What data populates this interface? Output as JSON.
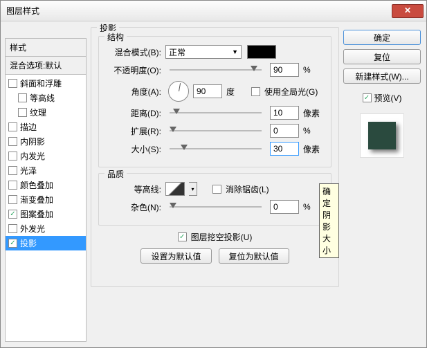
{
  "window": {
    "title": "图层样式"
  },
  "left": {
    "header": "样式",
    "sub": "混合选项:默认",
    "items": [
      {
        "label": "斜面和浮雕",
        "checked": false,
        "indent": false
      },
      {
        "label": "等高线",
        "checked": false,
        "indent": true
      },
      {
        "label": "纹理",
        "checked": false,
        "indent": true
      },
      {
        "label": "描边",
        "checked": false,
        "indent": false
      },
      {
        "label": "内阴影",
        "checked": false,
        "indent": false
      },
      {
        "label": "内发光",
        "checked": false,
        "indent": false
      },
      {
        "label": "光泽",
        "checked": false,
        "indent": false
      },
      {
        "label": "颜色叠加",
        "checked": false,
        "indent": false
      },
      {
        "label": "渐变叠加",
        "checked": false,
        "indent": false
      },
      {
        "label": "图案叠加",
        "checked": true,
        "indent": false
      },
      {
        "label": "外发光",
        "checked": false,
        "indent": false
      },
      {
        "label": "投影",
        "checked": true,
        "indent": false,
        "selected": true
      }
    ]
  },
  "main": {
    "title": "投影",
    "structure": {
      "title": "结构",
      "blend_mode_label": "混合模式(B):",
      "blend_mode_value": "正常",
      "color": "#000000",
      "opacity_label": "不透明度(O):",
      "opacity_value": "90",
      "opacity_unit": "%",
      "angle_label": "角度(A):",
      "angle_value": "90",
      "angle_unit": "度",
      "global_light_label": "使用全局光(G)",
      "global_light_checked": false,
      "distance_label": "距离(D):",
      "distance_value": "10",
      "distance_unit": "像素",
      "spread_label": "扩展(R):",
      "spread_value": "0",
      "spread_unit": "%",
      "size_label": "大小(S):",
      "size_value": "30",
      "size_unit": "像素"
    },
    "quality": {
      "title": "品质",
      "contour_label": "等高线:",
      "antialias_label": "消除锯齿(L)",
      "antialias_checked": false,
      "noise_label": "杂色(N):",
      "noise_value": "0",
      "noise_unit": "%"
    },
    "knockout_label": "图层挖空投影(U)",
    "knockout_checked": true,
    "set_default": "设置为默认值",
    "reset_default": "复位为默认值"
  },
  "right": {
    "ok": "确定",
    "cancel": "复位",
    "new_style": "新建样式(W)...",
    "preview_label": "预览(V)",
    "preview_checked": true
  },
  "tooltip": "确定阴影大小"
}
